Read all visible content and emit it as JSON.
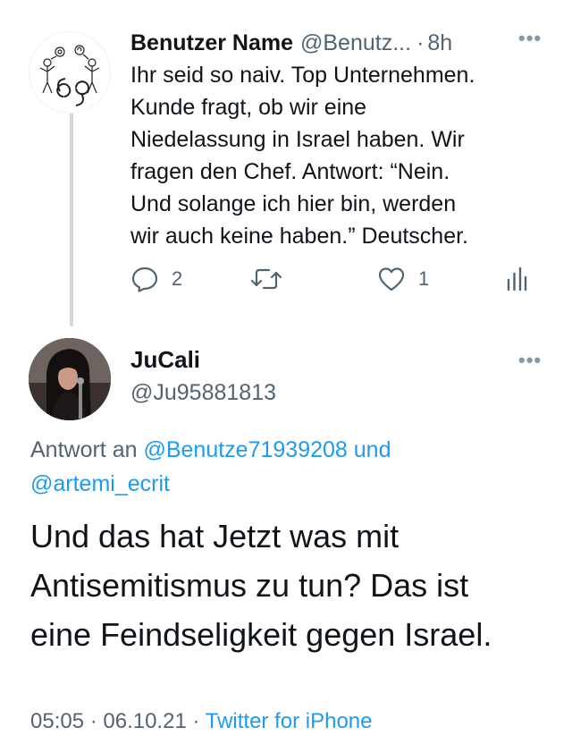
{
  "parent_tweet": {
    "display_name": "Benutzer Name",
    "handle": "@Benutz...",
    "separator": "·",
    "time": "8h",
    "more": "•••",
    "lines": [
      "Ihr seid so naiv. Top Unternehmen.",
      "Kunde fragt, ob wir eine",
      "Niedelassung in Israel haben. Wir",
      "fragen den Chef. Antwort: “Nein.",
      "Und solange ich hier bin, werden",
      "wir auch keine haben.” Deutscher."
    ],
    "actions": {
      "reply_icon": "reply-bubble-icon",
      "reply_count": "2",
      "retweet_icon": "retweet-icon",
      "like_icon": "heart-icon",
      "like_count": "1",
      "analytics_icon": "analytics-bars-icon"
    }
  },
  "main_tweet": {
    "display_name": "JuCali",
    "handle": "@Ju95881813",
    "more": "•••",
    "reply_prefix": "Antwort an",
    "reply_mention_1": "@Benutze71939208",
    "reply_connector": "und",
    "reply_mention_2": "@artemi_ecrit",
    "lines": [
      "Und das hat Jetzt was mit",
      "Antisemitismus zu tun? Das ist",
      "eine Feindseligkeit gegen Israel."
    ],
    "time": "05:05",
    "separator": "·",
    "date": "06.10.21",
    "separator_2": "·",
    "client": "Twitter for iPhone"
  },
  "colors": {
    "text": "#0f1419",
    "secondary": "#536471",
    "link": "#1d9bf0",
    "thread_line": "#cfd9de"
  }
}
